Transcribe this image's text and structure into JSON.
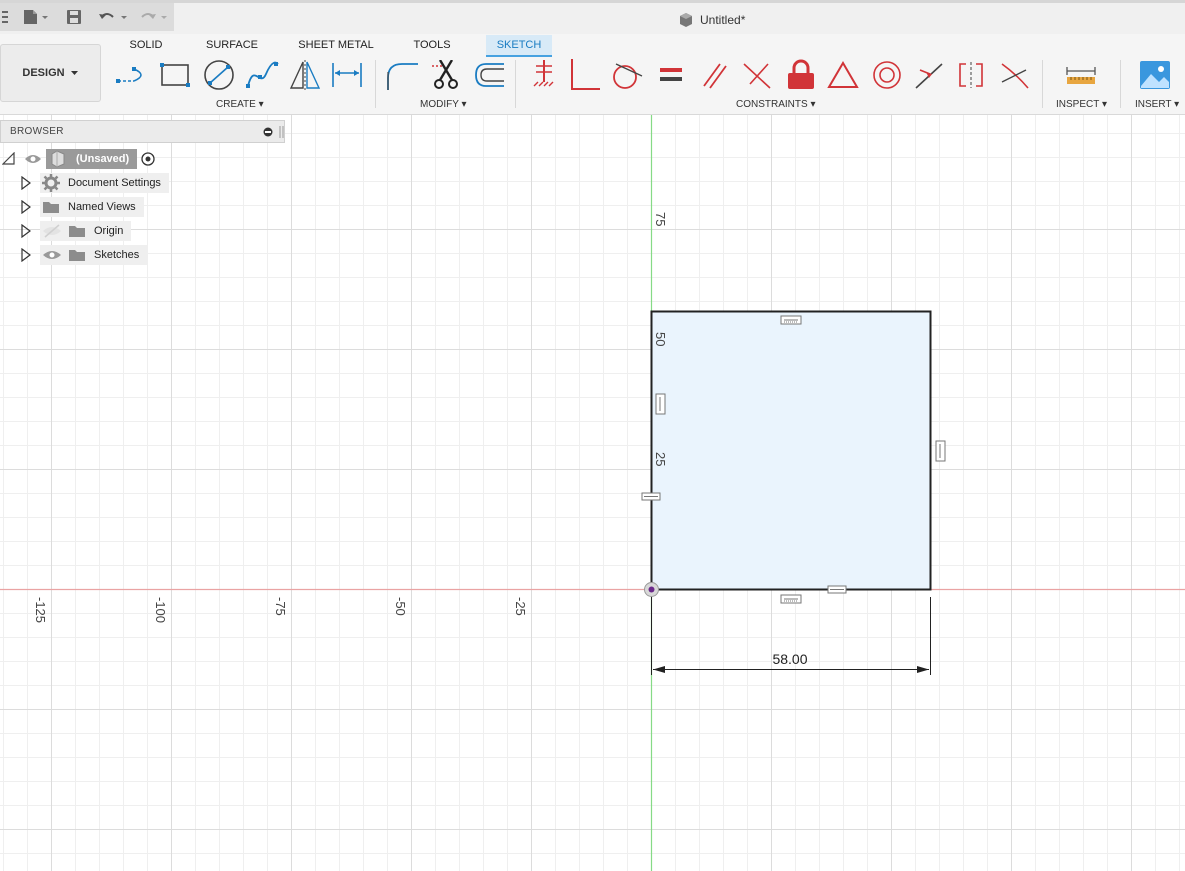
{
  "app": {
    "document_title": "Untitled*"
  },
  "ribbon": {
    "workspace_button": "DESIGN",
    "tabs": [
      {
        "label": "SOLID",
        "active": false
      },
      {
        "label": "SURFACE",
        "active": false
      },
      {
        "label": "SHEET METAL",
        "active": false
      },
      {
        "label": "TOOLS",
        "active": false
      },
      {
        "label": "SKETCH",
        "active": true
      }
    ],
    "groups": {
      "create": "CREATE",
      "modify": "MODIFY",
      "constraints": "CONSTRAINTS",
      "inspect": "INSPECT",
      "insert": "INSERT"
    }
  },
  "browser": {
    "title": "BROWSER",
    "root_label": "(Unsaved)",
    "items": [
      {
        "label": "Document Settings",
        "icon": "gear-icon"
      },
      {
        "label": "Named Views",
        "icon": "folder-icon"
      },
      {
        "label": "Origin",
        "icon": "folder-icon",
        "hidden": true
      },
      {
        "label": "Sketches",
        "icon": "folder-icon"
      }
    ]
  },
  "canvas": {
    "x_axis_ticks": [
      "-125",
      "-100",
      "-75",
      "-50",
      "-25"
    ],
    "y_axis_ticks": [
      "75",
      "50",
      "25"
    ],
    "dimension_value": "58.00"
  },
  "colors": {
    "accent": "#1a7cc2",
    "x_axis": "#e88a8a",
    "y_axis": "#6fd36f",
    "sketch_fill": "#eaf4fd",
    "constraint_red": "#d13438"
  }
}
